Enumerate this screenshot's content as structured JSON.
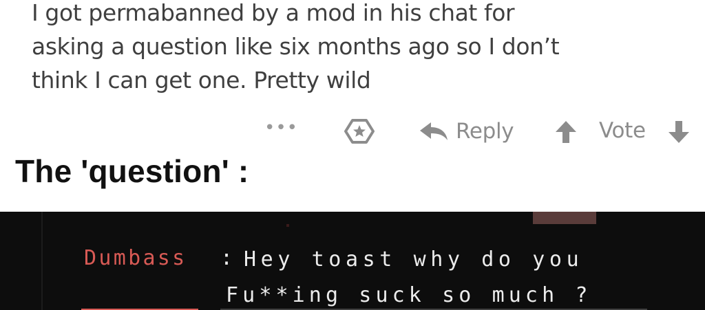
{
  "comment": {
    "lines": [
      "I got permabanned by a mod in his chat for",
      "asking a question like six months ago so I don’t",
      "think I can get one. Pretty wild"
    ]
  },
  "actions": {
    "more_label": "•••",
    "reply_label": "Reply",
    "vote_label": "Vote"
  },
  "caption": "The 'question' :",
  "chat": {
    "username": "Dumbass",
    "colon": ":",
    "message_line1": "Hey toast why do you",
    "message_line2": "Fu**ing suck so much ?"
  },
  "colors": {
    "comment_text": "#3f3f3f",
    "action_gray": "#8c8c8c",
    "chat_bg": "#0d0d0d",
    "chat_username": "#d85a55",
    "chat_text": "#ececec"
  }
}
